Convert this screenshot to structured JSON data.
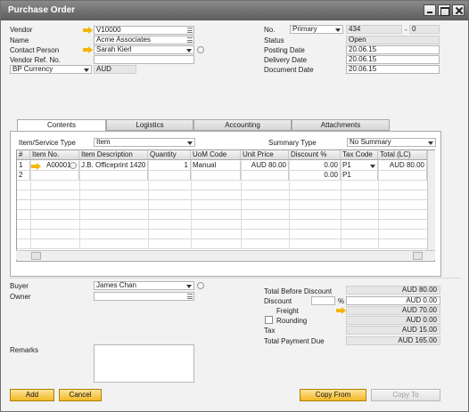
{
  "window": {
    "title": "Purchase Order"
  },
  "header_left": {
    "vendor_label": "Vendor",
    "vendor_value": "V10000",
    "name_label": "Name",
    "name_value": "Acme Associates",
    "contact_label": "Contact Person",
    "contact_value": "Sarah Kierl",
    "vendor_ref_label": "Vendor Ref. No.",
    "vendor_ref_value": "",
    "bp_currency_label": "BP Currency",
    "bp_currency_value": "AUD"
  },
  "header_right": {
    "no_label": "No.",
    "series_value": "Primary",
    "doc_no_value": "434",
    "doc_no_sep": "-",
    "doc_no_suffix": "0",
    "status_label": "Status",
    "status_value": "Open",
    "posting_label": "Posting Date",
    "posting_value": "20.06.15",
    "delivery_label": "Delivery Date",
    "delivery_value": "20.06.15",
    "document_label": "Document Date",
    "document_value": "20.06.15"
  },
  "tabs": [
    {
      "label": "Contents",
      "active": true
    },
    {
      "label": "Logistics",
      "active": false
    },
    {
      "label": "Accounting",
      "active": false
    },
    {
      "label": "Attachments",
      "active": false
    }
  ],
  "contents": {
    "item_type_label": "Item/Service Type",
    "item_type_value": "Item",
    "summary_type_label": "Summary Type",
    "summary_type_value": "No Summary",
    "columns": [
      "#",
      "Item No.",
      "Item Description",
      "Quantity",
      "UoM Code",
      "Unit Price",
      "Discount %",
      "Tax Code",
      "Total (LC)"
    ],
    "rows": [
      {
        "num": "1",
        "item_no": "A00001",
        "description": "J.B. Officeprint 1420",
        "quantity": "1",
        "uom": "Manual",
        "unit_price": "AUD 80.00",
        "discount": "0.00",
        "tax_code": "P1",
        "total": "AUD 80.00"
      },
      {
        "num": "2",
        "item_no": "",
        "description": "",
        "quantity": "",
        "uom": "",
        "unit_price": "",
        "discount": "0.00",
        "tax_code": "P1",
        "total": ""
      }
    ]
  },
  "footer_left": {
    "buyer_label": "Buyer",
    "buyer_value": "James Chan",
    "owner_label": "Owner",
    "owner_value": "",
    "remarks_label": "Remarks",
    "remarks_value": ""
  },
  "totals": {
    "before_discount_label": "Total Before Discount",
    "before_discount_value": "AUD 80.00",
    "discount_label": "Discount",
    "discount_pct_value": "",
    "discount_pct_symbol": "%",
    "discount_value": "AUD 0.00",
    "freight_label": "Freight",
    "freight_value": "AUD 70.00",
    "rounding_label": "Rounding",
    "rounding_value": "AUD 0.00",
    "tax_label": "Tax",
    "tax_value": "AUD 15.00",
    "total_label": "Total Payment Due",
    "total_value": "AUD 165.00"
  },
  "buttons": {
    "add": "Add",
    "cancel": "Cancel",
    "copy_from": "Copy From",
    "copy_to": "Copy To"
  },
  "icons": [
    "link-arrow-icon",
    "list-icon",
    "dropdown-arrow-icon",
    "details-icon",
    "minimize-icon",
    "maximize-icon",
    "close-icon"
  ],
  "colors": {
    "accent": "#f4b824",
    "link_arrow": "#f2b705",
    "titlebar": "#6e6e6e"
  }
}
